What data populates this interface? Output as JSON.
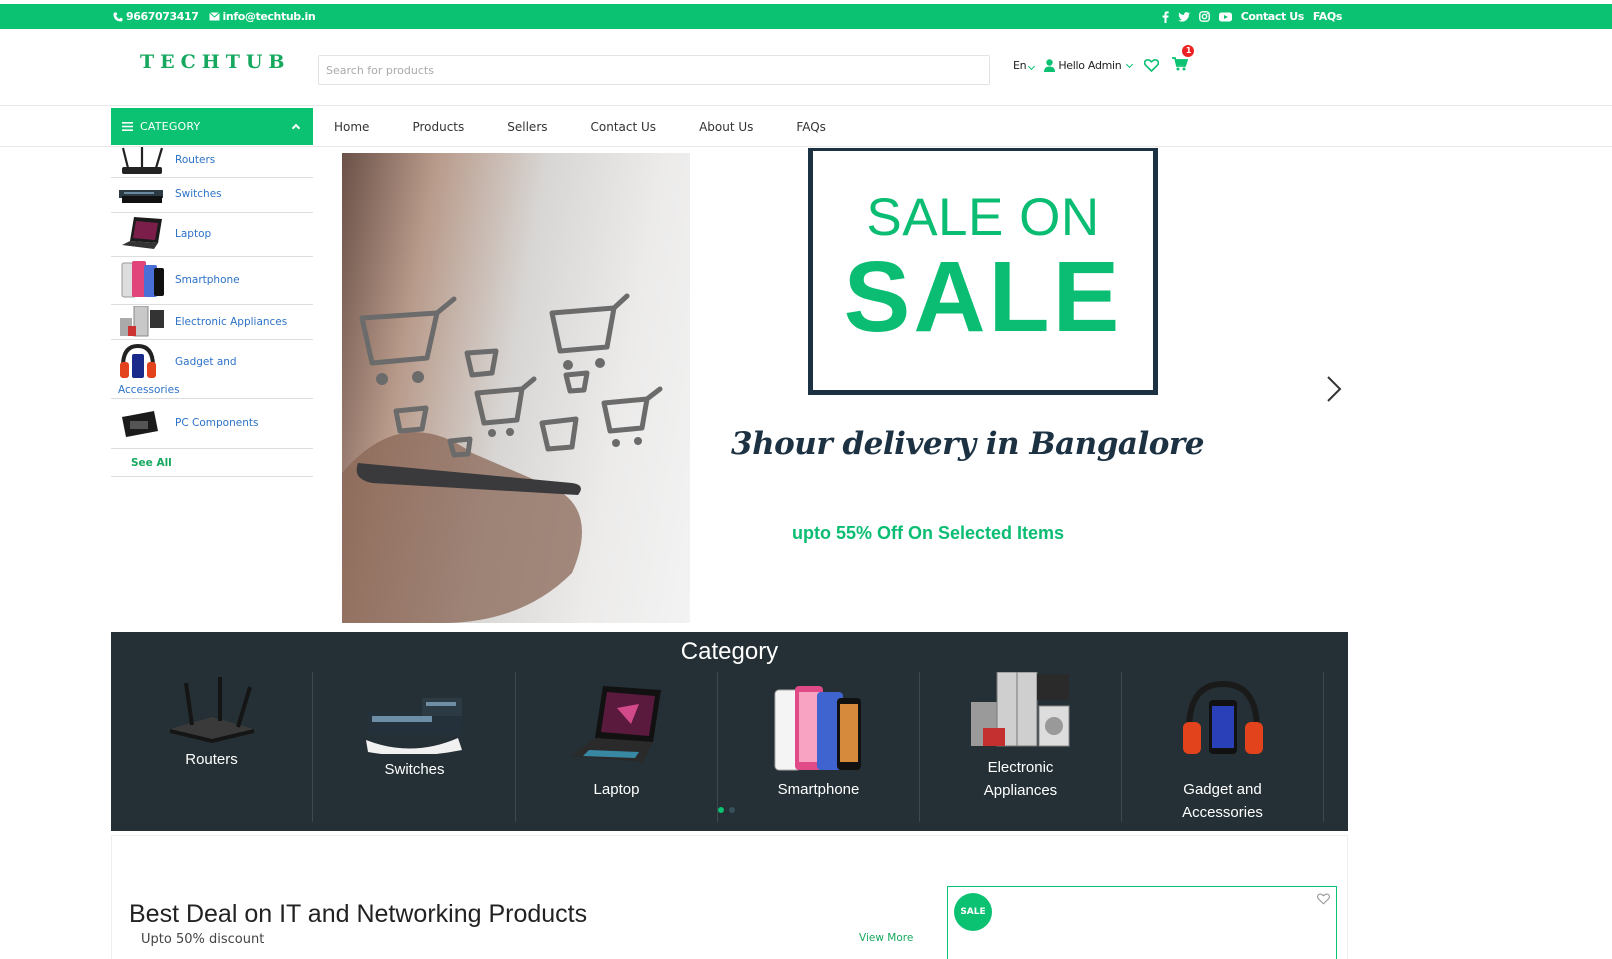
{
  "topbar": {
    "phone": "9667073417",
    "email": "info@techtub.in",
    "contact_label": "Contact Us",
    "faqs_label": "FAQs"
  },
  "header": {
    "logo_text": "TECHTUB",
    "search_placeholder": "Search for products",
    "language": "En",
    "user_greeting": "Hello Admin",
    "cart_count": "1"
  },
  "nav": {
    "category_label": "CATEGORY",
    "links": [
      "Home",
      "Products",
      "Sellers",
      "Contact Us",
      "About Us",
      "FAQs"
    ]
  },
  "sidebar": {
    "items": [
      {
        "label": "Routers",
        "icon": "router-icon"
      },
      {
        "label": "Switches",
        "icon": "switch-icon"
      },
      {
        "label": "Laptop",
        "icon": "laptop-icon"
      },
      {
        "label": "Smartphone",
        "icon": "smartphone-icon"
      },
      {
        "label": "Electronic Appliances",
        "icon": "appliance-icon"
      },
      {
        "label": "Gadget and",
        "label2": "Accessories",
        "icon": "headphones-icon"
      },
      {
        "label": "PC Components",
        "icon": "pc-component-icon"
      }
    ],
    "see_all": "See All"
  },
  "banner": {
    "sale_line1": "SALE ON",
    "sale_line2": "SALE",
    "delivery_text": "3hour delivery in Bangalore",
    "offer_text": "upto 55% Off On Selected Items"
  },
  "category_strip": {
    "title": "Category",
    "cards": [
      {
        "label": "Routers",
        "label2": ""
      },
      {
        "label": "Switches",
        "label2": ""
      },
      {
        "label": "Laptop",
        "label2": ""
      },
      {
        "label": "Smartphone",
        "label2": ""
      },
      {
        "label": "Electronic",
        "label2": "Appliances"
      },
      {
        "label": "Gadget and",
        "label2": "Accessories"
      }
    ]
  },
  "deal": {
    "title": "Best Deal on IT and Networking Products",
    "subtitle": "Upto 50% discount",
    "view_more": "View More",
    "sale_badge": "SALE"
  },
  "colors": {
    "accent": "#0bc172",
    "dark_panel": "#243035",
    "navy": "#1c3142",
    "link_blue": "#2c72c7"
  }
}
